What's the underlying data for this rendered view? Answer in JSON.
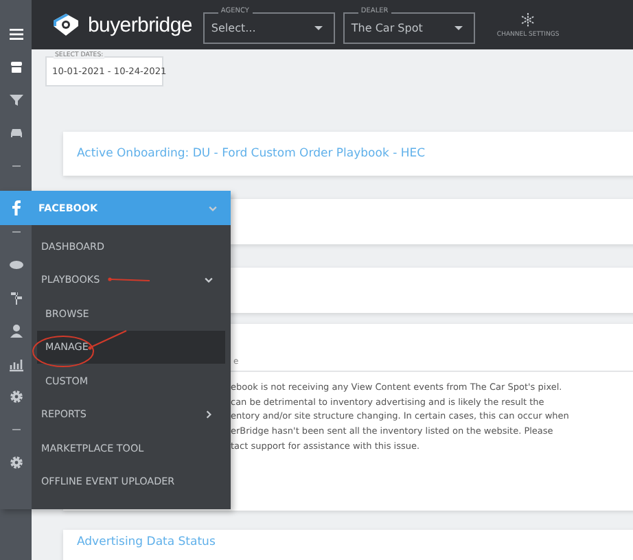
{
  "topbar": {
    "logo_text": "buyerbridge",
    "agency": {
      "label": "AGENCY",
      "value": "Select..."
    },
    "dealer": {
      "label": "DEALER",
      "value": "The Car Spot"
    },
    "channel_settings": "CHANNEL SETTINGS"
  },
  "date_range": {
    "label": "SELECT DATES:",
    "value": "10-01-2021 - 10-24-2021"
  },
  "cards": [
    {
      "kind": "link",
      "title": "Active Onboarding: DU - Ford Custom Order Playbook - HEC"
    },
    {
      "kind": "empty"
    },
    {
      "kind": "empty"
    },
    {
      "kind": "notice",
      "heading": "e",
      "lines": [
        "ebook is not receiving any View Content events from The Car Spot's pixel.",
        "can be detrimental to inventory advertising and is likely the result the",
        "entory and/or site structure changing. In certain cases, this can occur when",
        "erBridge hasn't been sent all the inventory listed on the website. Please",
        "tact support for assistance with this issue."
      ]
    },
    {
      "kind": "link",
      "title": "Advertising Data Status"
    }
  ],
  "menu": {
    "header": {
      "label": "FACEBOOK",
      "expanded": true
    },
    "items": [
      {
        "kind": "link",
        "label": "DASHBOARD",
        "selected": false
      },
      {
        "kind": "group",
        "label": "PLAYBOOKS",
        "expanded": true,
        "children": [
          {
            "label": "BROWSE",
            "selected": false
          },
          {
            "label": "MANAGE",
            "selected": true
          },
          {
            "label": "CUSTOM",
            "selected": false
          }
        ]
      },
      {
        "kind": "group",
        "label": "REPORTS",
        "expanded": false
      },
      {
        "kind": "link",
        "label": "MARKETPLACE TOOL",
        "selected": false
      },
      {
        "kind": "link",
        "label": "OFFLINE EVENT UPLOADER",
        "selected": false
      }
    ]
  }
}
